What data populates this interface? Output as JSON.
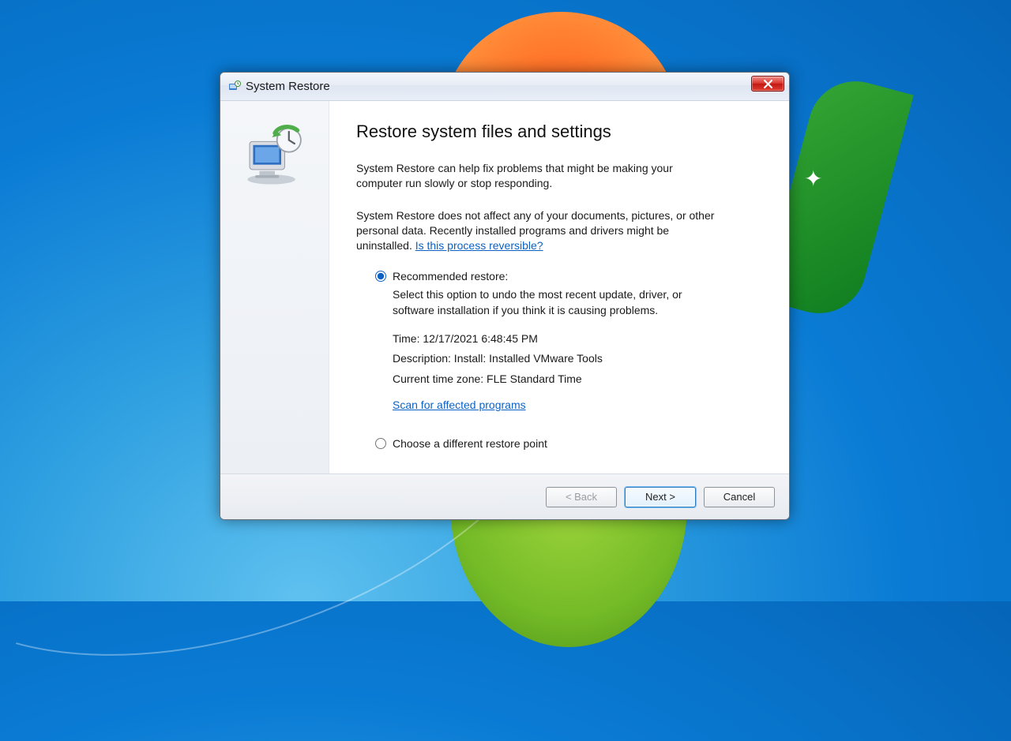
{
  "window": {
    "title": "System Restore"
  },
  "main": {
    "heading": "Restore system files and settings",
    "para1": "System Restore can help fix problems that might be making your computer run slowly or stop responding.",
    "para2_pre": "System Restore does not affect any of your documents, pictures, or other personal data. Recently installed programs and drivers might be uninstalled. ",
    "para2_link": "Is this process reversible?"
  },
  "options": {
    "recommended": {
      "label": "Recommended restore:",
      "desc": "Select this option to undo the most recent update, driver, or software installation if you think it is causing problems.",
      "time": "Time: 12/17/2021 6:48:45 PM",
      "description": "Description: Install: Installed VMware Tools",
      "timezone": "Current time zone: FLE Standard Time",
      "scan_link": "Scan for affected programs"
    },
    "different": {
      "label": "Choose a different restore point"
    }
  },
  "footer": {
    "back": "< Back",
    "next": "Next >",
    "cancel": "Cancel"
  }
}
